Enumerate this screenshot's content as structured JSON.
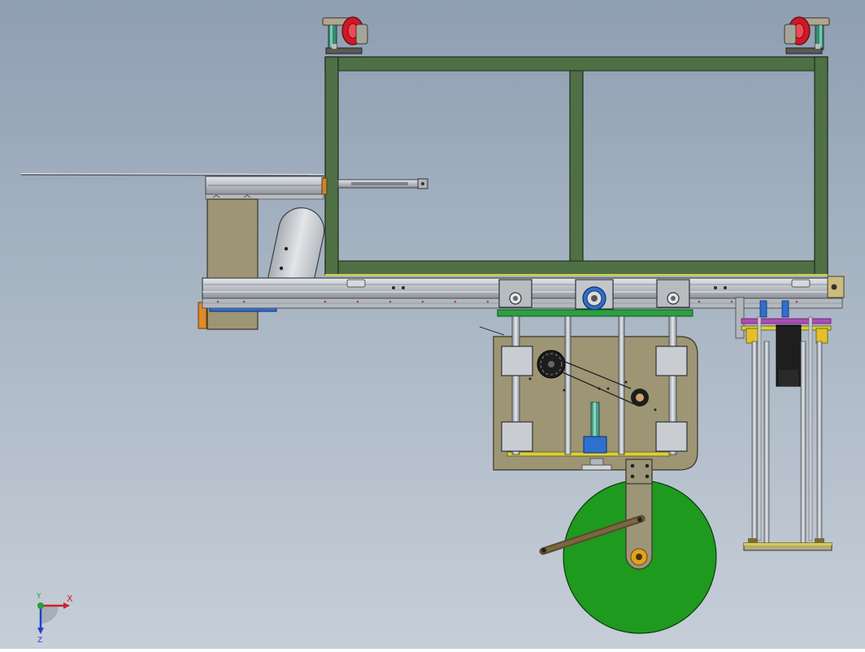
{
  "viewport": {
    "background_top": "#8f9fb2",
    "background_bottom": "#c6ced8"
  },
  "colors": {
    "frame_green": "#4f7045",
    "frame_outline": "#1f2b1a",
    "plate_tan": "#9d9574",
    "rail_silver": "#c3c7cc",
    "wheel_green": "#1e9a1e",
    "caster_red": "#d01826",
    "motor_blue": "#2f6fd0",
    "accent_yellow": "#e0d23a",
    "magenta_link": "#b04ab8"
  },
  "triad": {
    "x_label": "X",
    "y_label": "Y",
    "z_label": "Z",
    "x_color": "#d0202a",
    "y_color": "#22a033",
    "z_color": "#2040c8"
  }
}
